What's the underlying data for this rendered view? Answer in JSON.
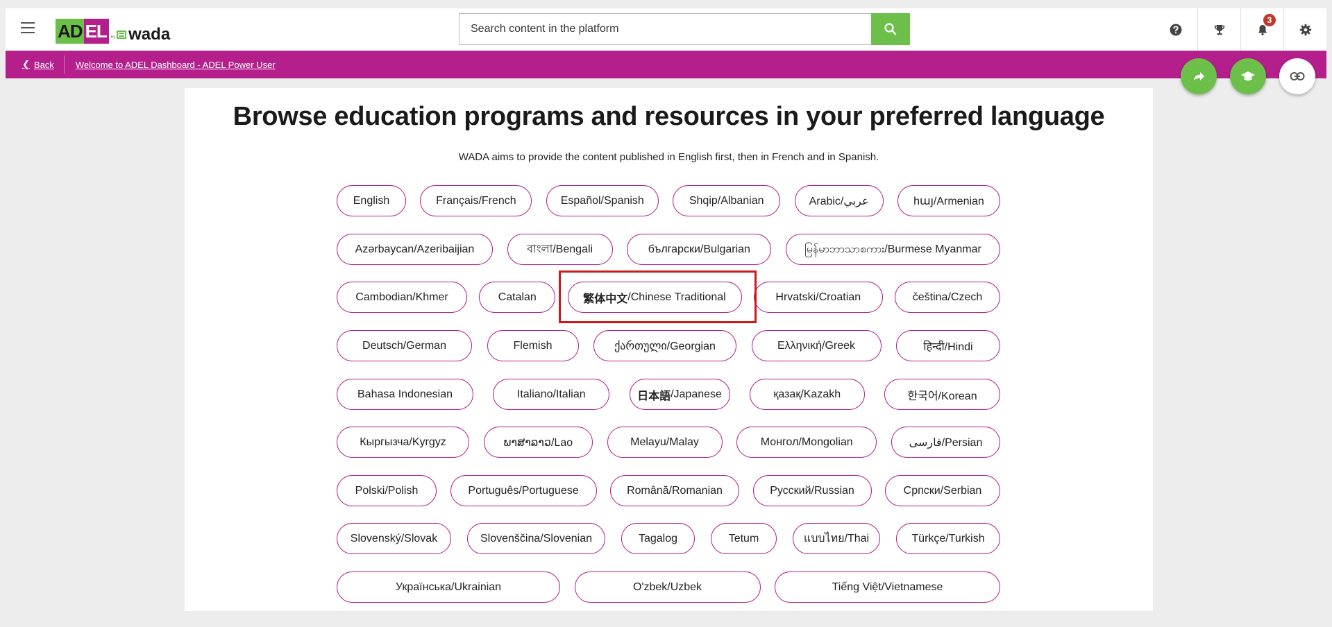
{
  "header": {
    "logo": {
      "ad": "AD",
      "el": "EL",
      "by": "by",
      "wada": "wada"
    },
    "search": {
      "placeholder": "Search content in the platform"
    },
    "notifications": {
      "count": "3"
    }
  },
  "subnav": {
    "back_label": "Back",
    "breadcrumb": "Welcome to ADEL Dashboard - ADEL Power User"
  },
  "main": {
    "title": "Browse education programs and resources in your preferred language",
    "subtitle": "WADA aims to provide the content published in English first, then in French and in Spanish.",
    "languages": {
      "r0": [
        "English",
        "Français/French",
        "Español/Spanish",
        "Shqip/Albanian",
        "Arabic/عربي",
        "hայ/Armenian"
      ],
      "r1": [
        "Azərbaycan/Azeribaijian",
        "বাংলা/Bengali",
        "български/Bulgarian",
        "မြန်မာဘာသာစကား/Burmese Myanmar"
      ],
      "r2": [
        "Cambodian/Khmer",
        "Catalan",
        "/Chinese Traditional",
        "Hrvatski/Croatian",
        "čeština/Czech"
      ],
      "r2_bold": "繁体中文",
      "r3": [
        "Deutsch/German",
        "Flemish",
        "ქართული/Georgian",
        "Ελληνική/Greek",
        "हिन्दी/Hindi"
      ],
      "r4": [
        "Bahasa Indonesian",
        "Italiano/Italian",
        "/Japanese",
        "қазақ/Kazakh",
        "한국어/Korean"
      ],
      "r4_bold": "日本語",
      "r5": [
        "Кыргызча/Kyrgyz",
        "ພາສາລາວ/Lao",
        "Melayu/Malay",
        "Монгол/Mongolian",
        "فارسی/Persian"
      ],
      "r6": [
        "Polski/Polish",
        "Português/Portuguese",
        "Română/Romanian",
        "Русский/Russian",
        "Српски/Serbian"
      ],
      "r7": [
        "Slovenský/Slovak",
        "Slovenščina/Slovenian",
        "Tagalog",
        "Tetum",
        "แบบไทย/Thai",
        "Türkçe/Turkish"
      ],
      "r8": [
        "Українська/Ukrainian",
        "O'zbek/Uzbek",
        "Tiếng Việt/Vietnamese"
      ]
    }
  },
  "colors": {
    "brand_magenta": "#b41f8c",
    "brand_green": "#6cc04a",
    "highlight": "#cc1a1a"
  }
}
